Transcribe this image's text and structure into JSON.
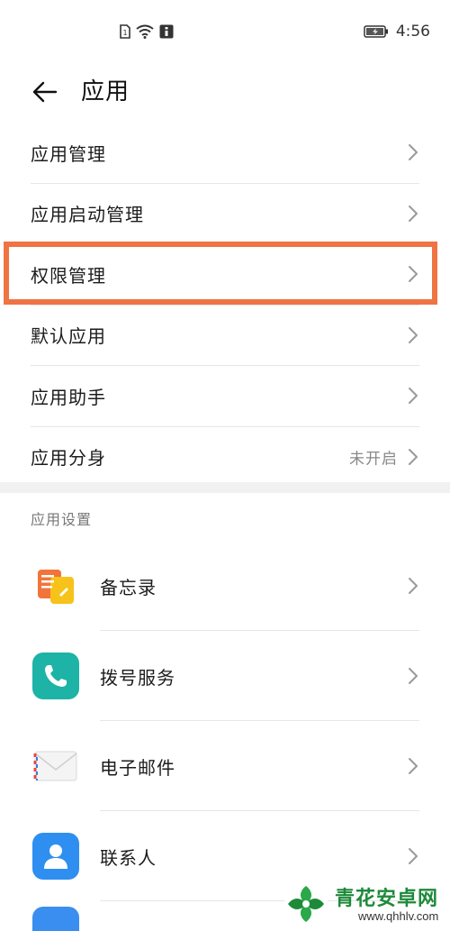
{
  "status_bar": {
    "icons_center": [
      "sim-icon",
      "wifi-icon",
      "info-badge-icon"
    ],
    "battery_icon": "battery-charging-icon",
    "time": "4:56"
  },
  "header": {
    "back_icon": "back-arrow-icon",
    "title": "应用"
  },
  "menu": {
    "items": [
      {
        "label": "应用管理",
        "value": ""
      },
      {
        "label": "应用启动管理",
        "value": ""
      },
      {
        "label": "权限管理",
        "value": "",
        "highlighted": true
      },
      {
        "label": "默认应用",
        "value": ""
      },
      {
        "label": "应用助手",
        "value": ""
      },
      {
        "label": "应用分身",
        "value": "未开启"
      }
    ],
    "highlight_color": "#f07343"
  },
  "app_settings": {
    "section_title": "应用设置",
    "apps": [
      {
        "label": "备忘录",
        "icon": "notes-icon"
      },
      {
        "label": "拨号服务",
        "icon": "phone-icon"
      },
      {
        "label": "电子邮件",
        "icon": "email-icon"
      },
      {
        "label": "联系人",
        "icon": "contacts-icon"
      }
    ]
  },
  "watermark": {
    "title": "青花安卓网",
    "url": "www.qhhlv.com",
    "color": "#1d8a3a"
  }
}
